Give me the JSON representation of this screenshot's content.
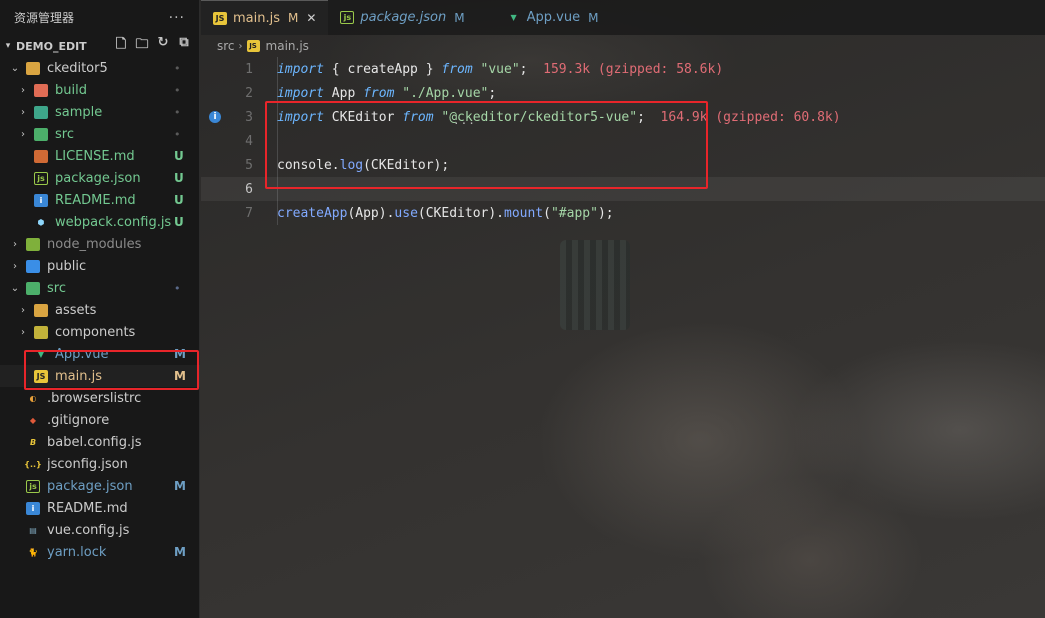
{
  "sidebar": {
    "title": "资源管理器",
    "more": "···",
    "root": "DEMO_EDIT",
    "items": [
      {
        "label": "ckeditor5",
        "status": "•"
      },
      {
        "label": "build",
        "status": "•"
      },
      {
        "label": "sample",
        "status": "•"
      },
      {
        "label": "src",
        "status": "•"
      },
      {
        "label": "LICENSE.md",
        "status": "U"
      },
      {
        "label": "package.json",
        "status": "U"
      },
      {
        "label": "README.md",
        "status": "U"
      },
      {
        "label": "webpack.config.js",
        "status": "U"
      },
      {
        "label": "node_modules",
        "status": ""
      },
      {
        "label": "public",
        "status": ""
      },
      {
        "label": "src",
        "status": "•"
      },
      {
        "label": "assets",
        "status": ""
      },
      {
        "label": "components",
        "status": ""
      },
      {
        "label": "App.vue",
        "status": "M"
      },
      {
        "label": "main.js",
        "status": "M"
      },
      {
        "label": ".browserslistrc",
        "status": ""
      },
      {
        "label": ".gitignore",
        "status": ""
      },
      {
        "label": "babel.config.js",
        "status": ""
      },
      {
        "label": "jsconfig.json",
        "status": ""
      },
      {
        "label": "package.json",
        "status": "M"
      },
      {
        "label": "README.md",
        "status": ""
      },
      {
        "label": "vue.config.js",
        "status": ""
      },
      {
        "label": "yarn.lock",
        "status": "M"
      }
    ]
  },
  "tabs": [
    {
      "label": "main.js",
      "status": "M",
      "close": "✕"
    },
    {
      "label": "package.json",
      "status": "M"
    },
    {
      "label": "App.vue",
      "status": "M"
    }
  ],
  "breadcrumb": {
    "part1": "src",
    "part2": "main.js"
  },
  "code": {
    "line_numbers": [
      "1",
      "2",
      "3",
      "4",
      "5",
      "6",
      "7"
    ],
    "l1": {
      "kw1": "import",
      "a": " { createApp } ",
      "kw2": "from",
      "s": " \"vue\"",
      "end": ";",
      "hint": "  159.3k (gzipped: 58.6k)"
    },
    "l2": {
      "kw1": "import",
      "a": " App ",
      "kw2": "from",
      "s": " \"./App.vue\"",
      "end": ";"
    },
    "l3": {
      "kw1": "import",
      "a": " CKEditor ",
      "kw2": "from",
      "s": " \"@ckeditor/ckeditor5-vue\"",
      "end": ";",
      "hint": "  164.9k (gzipped: 60.8k)"
    },
    "l5": {
      "a": "console",
      "b": ".",
      "fn": "log",
      "c": "(CKEditor);"
    },
    "l7": {
      "fn1": "createApp",
      "a": "(App).",
      "fn2": "use",
      "b": "(CKEditor).",
      "fn3": "mount",
      "c": "(",
      "s": "\"#app\"",
      "d": ");"
    },
    "dots": "···"
  },
  "colors": {
    "accent_modified": "#73c991",
    "highlight_red": "#e8252a",
    "keyword": "#6cb6ff",
    "string": "#a5d6a7",
    "size_hint": "#e06c75"
  }
}
